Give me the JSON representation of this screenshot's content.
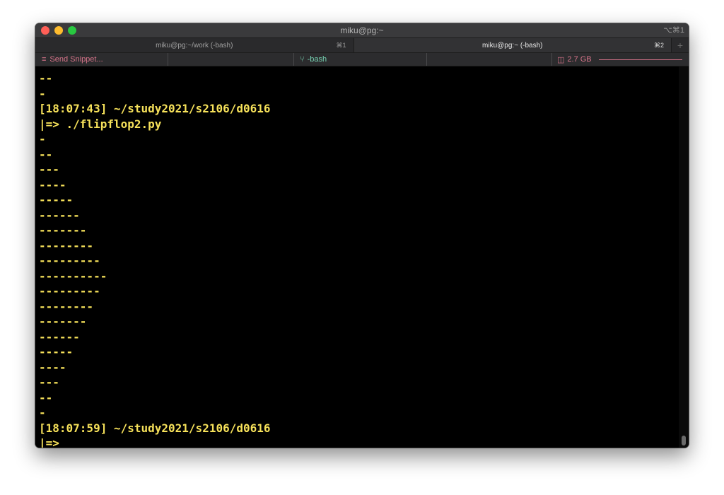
{
  "window": {
    "title": "miku@pg:~",
    "shortcut": "⌥⌘1"
  },
  "tabs": [
    {
      "label": "miku@pg:~/work (-bash)",
      "shortcut": "⌘1",
      "active": false
    },
    {
      "label": "miku@pg:~ (-bash)",
      "shortcut": "⌘2",
      "active": true
    }
  ],
  "tab_add": "+",
  "statusbar": {
    "snippet_icon": "≡",
    "snippet_label": "Send Snippet...",
    "bash_icon": "⑂",
    "bash_label": "-bash",
    "memory_icon": "◫",
    "memory_label": "2.7 GB"
  },
  "terminal": {
    "lines": [
      "--",
      "-",
      "[18:07:43] ~/study2021/s2106/d0616",
      "|=> ./flipflop2.py",
      "-",
      "--",
      "---",
      "----",
      "-----",
      "------",
      "-------",
      "--------",
      "---------",
      "----------",
      "---------",
      "--------",
      "-------",
      "------",
      "-----",
      "----",
      "---",
      "--",
      "-",
      "[18:07:59] ~/study2021/s2106/d0616",
      "|=>"
    ]
  },
  "colors": {
    "text": "#f6e15a",
    "statusbar_accent": "#d6748a",
    "bash_accent": "#77d4b4"
  }
}
